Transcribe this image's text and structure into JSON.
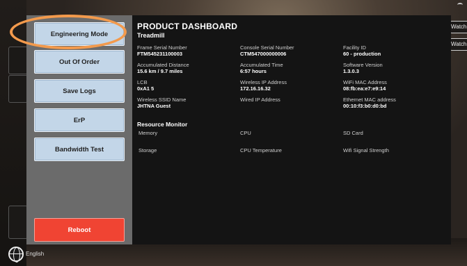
{
  "background": {
    "top_right_button_1": "Watch",
    "top_right_button_2": "Watch",
    "language": "English"
  },
  "menu": {
    "engineering_mode": "Engineering Mode",
    "out_of_order": "Out Of Order",
    "save_logs": "Save Logs",
    "erp": "ErP",
    "bandwidth_test": "Bandwidth Test",
    "reboot": "Reboot"
  },
  "dashboard": {
    "title": "PRODUCT DASHBOARD",
    "subtitle": "Treadmill",
    "fields": [
      {
        "label": "Frame Serial Number",
        "value": "FTM545231100003"
      },
      {
        "label": "Console Serial Number",
        "value": "CTM547000000006"
      },
      {
        "label": "Facility ID",
        "value": "60 - production"
      },
      {
        "label": "Accumulated Distance",
        "value": "15.6 km / 9.7 miles"
      },
      {
        "label": "Accumulated Time",
        "value": "6:57 hours"
      },
      {
        "label": "Software Version",
        "value": "1.3.0.3"
      },
      {
        "label": "LCB",
        "value": "0xA1 5"
      },
      {
        "label": "Wireless IP Address",
        "value": "172.16.16.32"
      },
      {
        "label": "WiFi MAC Address",
        "value": "08:fb:ea:e7:e9:14"
      },
      {
        "label": "Wireless SSID Name",
        "value": "JHTNA Guest"
      },
      {
        "label": "Wired IP Address",
        "value": ""
      },
      {
        "label": "Ethernet MAC address",
        "value": "00:10:f3:b0:d0:bd"
      }
    ],
    "resource_monitor": {
      "title": "Resource Monitor",
      "items": [
        "Memory",
        "CPU",
        "SD Card",
        "Storage",
        "CPU Temperature",
        "Wifi Signal Strength"
      ]
    }
  },
  "colors": {
    "menu_button": "#c3d6e8",
    "reboot_button": "#f04433",
    "highlight": "#f39a4c",
    "panel": "#141414",
    "menu_panel": "#6b6b6b"
  }
}
